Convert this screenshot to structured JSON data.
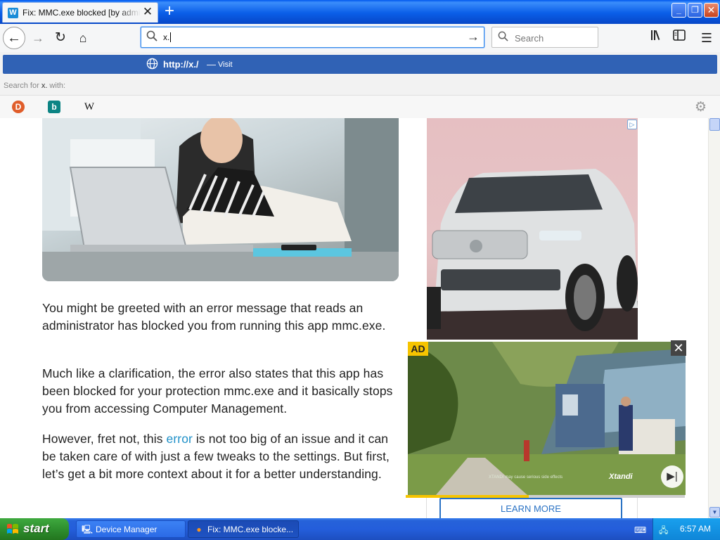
{
  "browser": {
    "tab_title": "Fix: MMC.exe blocked [by administrator]",
    "tab_favicon": "W",
    "url_input": "x.",
    "search_placeholder": "Search"
  },
  "popup": {
    "suggestion_url": "http://x./",
    "suggestion_separator": "—",
    "suggestion_action": "Visit",
    "search_for_prefix": "Search for ",
    "search_for_term": "x.",
    "search_for_suffix": " with:",
    "engines": [
      "duckduckgo-icon",
      "bing-icon",
      "wikipedia-icon"
    ],
    "engine_glyphs": {
      "duckduckgo": "D",
      "bing": "b",
      "wikipedia": "W"
    }
  },
  "article": {
    "p1": "You might be greeted with an error message that reads an administrator has blocked you from running this app mmc.exe.",
    "p2": "Much like a clarification, the error also states that this app has been blocked for your protection mmc.exe and it basically stops you from accessing Computer Management.",
    "p3_before": "However, fret not, this ",
    "p3_link": "error",
    "p3_after": " is not too big of an issue and it can be taken care of with just a few tweaks to the settings. But first, let’s get a bit more context about it for a better understanding."
  },
  "ads": {
    "video_label": "AD",
    "disclaimer": "XTANDI may cause serious side effects",
    "brand": "Xtandi",
    "learn_more": "LEARN MORE",
    "progress_fraction": 0.44
  },
  "taskbar": {
    "start_label": "start",
    "tasks": [
      {
        "label": "Device Manager"
      },
      {
        "label": "Fix: MMC.exe blocke..."
      }
    ],
    "clock": "6:57 AM"
  },
  "colors": {
    "accent": "#3062b5",
    "link": "#1e90c8",
    "ad_label": "#f6c400",
    "learn_more": "#2a72c4"
  }
}
